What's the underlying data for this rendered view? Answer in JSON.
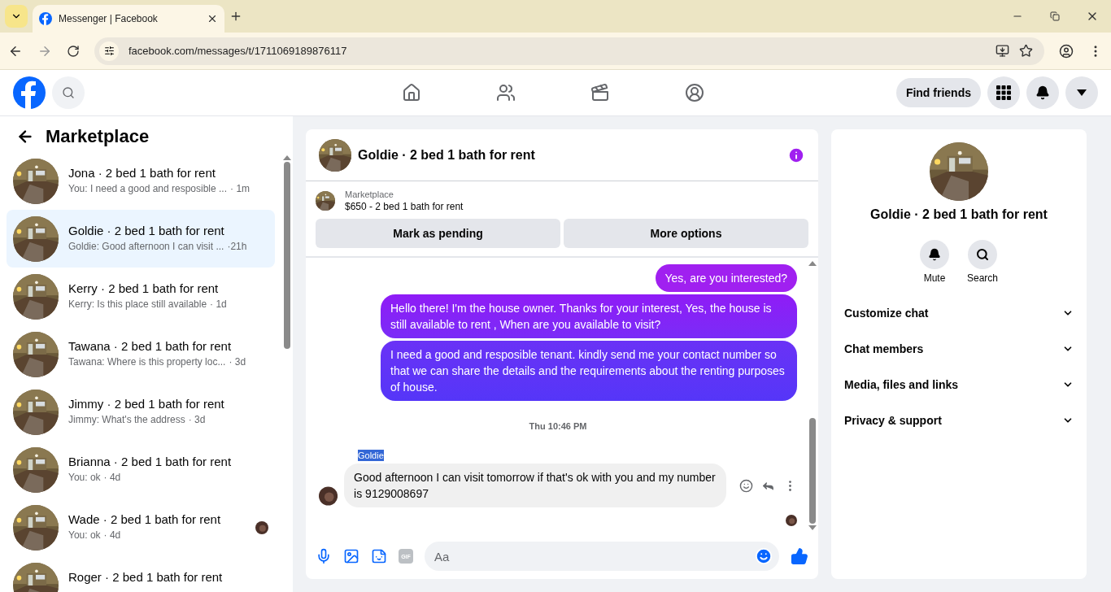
{
  "browser": {
    "tab_title": "Messenger | Facebook",
    "url": "facebook.com/messages/t/1711069189876117"
  },
  "topbar": {
    "find_friends": "Find friends"
  },
  "sidebar": {
    "title": "Marketplace",
    "conversations": [
      {
        "name": "Jona · 2 bed 1 bath for rent",
        "preview": "You: I need a good and resposible ...",
        "time": "· 1m",
        "selected": false,
        "read_receipt": false
      },
      {
        "name": "Goldie · 2 bed 1 bath for rent",
        "preview": "Goldie: Good afternoon I can visit ...",
        "time": "·21h",
        "selected": true,
        "read_receipt": false
      },
      {
        "name": "Kerry · 2 bed 1 bath for rent",
        "preview": "Kerry: Is this place still available",
        "time": "· 1d",
        "selected": false,
        "read_receipt": false
      },
      {
        "name": "Tawana · 2 bed 1 bath for rent",
        "preview": "Tawana: Where is this property loc...",
        "time": "· 3d",
        "selected": false,
        "read_receipt": false
      },
      {
        "name": "Jimmy · 2 bed 1 bath for rent",
        "preview": "Jimmy: What's the address",
        "time": "· 3d",
        "selected": false,
        "read_receipt": false
      },
      {
        "name": "Brianna · 2 bed 1 bath for rent",
        "preview": "You: ok",
        "time": "· 4d",
        "selected": false,
        "read_receipt": false
      },
      {
        "name": "Wade · 2 bed 1 bath for rent",
        "preview": "You: ok",
        "time": "· 4d",
        "selected": false,
        "read_receipt": true
      },
      {
        "name": "Roger · 2 bed 1 bath for rent",
        "selected": false,
        "read_receipt": false
      }
    ]
  },
  "chat": {
    "title": "Goldie · 2 bed 1 bath for rent",
    "listing": {
      "source": "Marketplace",
      "price": "$650 - 2 bed 1 bath for rent",
      "buttons": [
        "Mark as pending",
        "More options"
      ]
    },
    "messages": [
      {
        "kind": "sent",
        "text": "Yes, are you interested?"
      },
      {
        "kind": "sent",
        "text": "Hello there! I'm the house owner. Thanks for your interest, Yes, the house is still available to rent , When are you available to visit?"
      },
      {
        "kind": "sent",
        "text": "I need a good and resposible tenant.  kindly send me your contact number so that we can share the details and the requirements about the renting purposes of house."
      },
      {
        "kind": "time",
        "text": "Thu 10:46 PM"
      },
      {
        "kind": "sender",
        "text": "Goldie",
        "highlighted": true
      },
      {
        "kind": "received",
        "text": "Good afternoon I can visit tomorrow if that's ok with you and my number is 9129008697"
      }
    ],
    "gif_label": "GIF",
    "composer_placeholder": "Aa"
  },
  "details": {
    "title": "Goldie · 2 bed 1 bath for rent",
    "actions": [
      {
        "kind": "mute",
        "label": "Mute"
      },
      {
        "kind": "search",
        "label": "Search"
      }
    ],
    "sections": [
      "Customize chat",
      "Chat members",
      "Media, files and links",
      "Privacy & support"
    ]
  }
}
